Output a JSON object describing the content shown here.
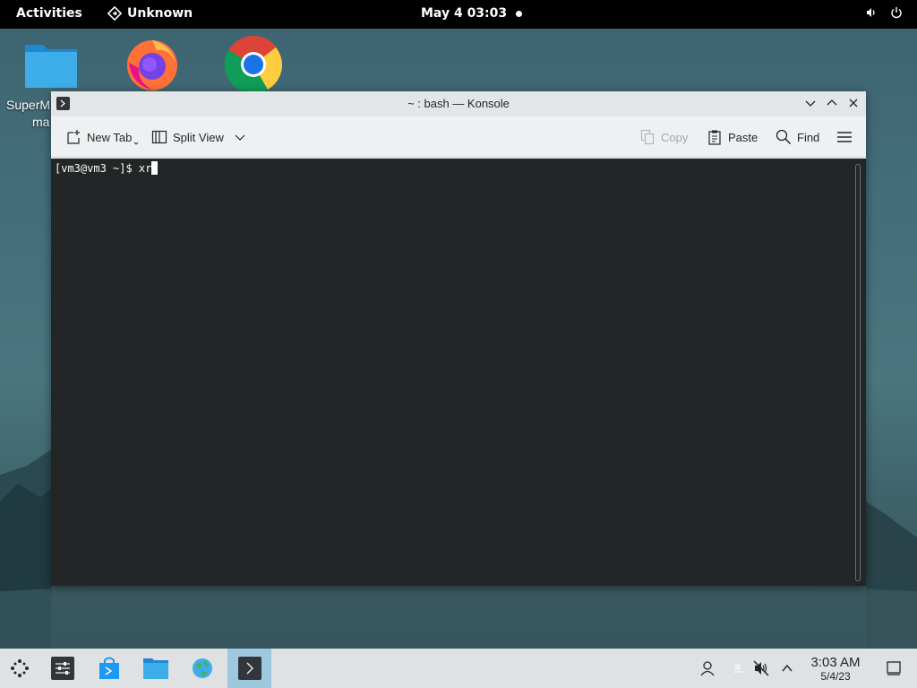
{
  "topbar": {
    "activities": "Activities",
    "app_name": "Unknown",
    "clock": "May 4  03:03"
  },
  "desktop": {
    "icons": [
      {
        "label_line1": "SuperM",
        "label_line2": "ma",
        "icon": "folder-icon"
      },
      {
        "icon": "firefox-icon"
      },
      {
        "icon": "chrome-icon"
      }
    ]
  },
  "window": {
    "title": "~ : bash — Konsole",
    "toolbar": {
      "new_tab": "New Tab",
      "split_view": "Split View",
      "copy": "Copy",
      "paste": "Paste",
      "find": "Find"
    },
    "terminal": {
      "prompt": "[vm3@vm3 ~]$ ",
      "input": "xr"
    }
  },
  "taskbar": {
    "time": "3:03 AM",
    "date": "5/4/23"
  },
  "colors": {
    "terminal_bg": "#232627",
    "active_task": "#9ec8de",
    "topbar": "#000000"
  }
}
